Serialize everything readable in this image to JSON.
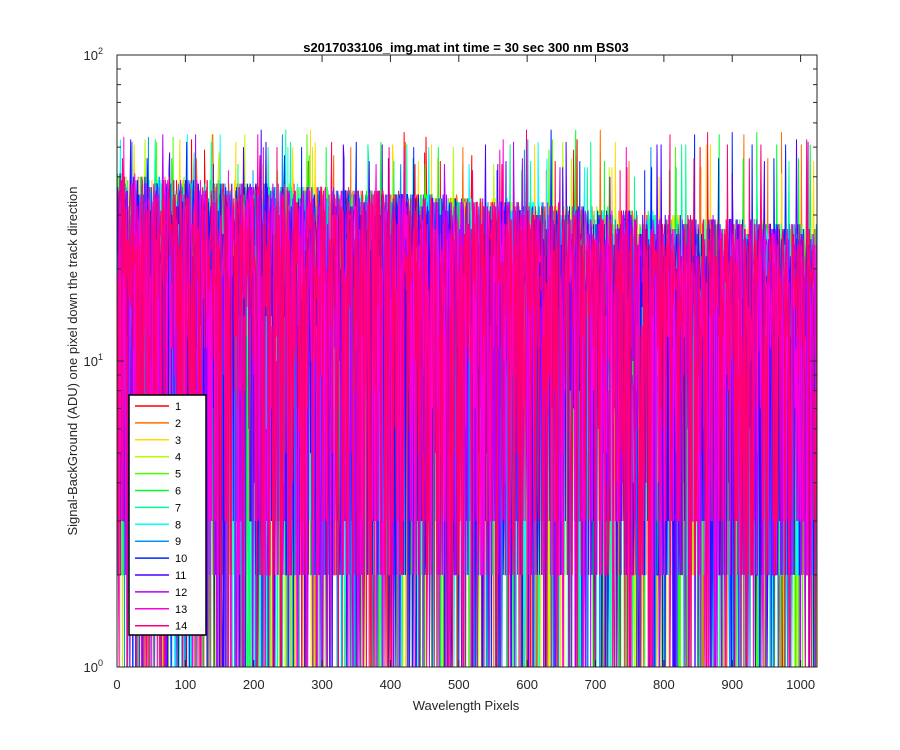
{
  "chart_data": {
    "type": "line",
    "title": "s2017033106_img.mat int time = 30 sec  300 nm BS03",
    "xlabel": "Wavelength Pixels",
    "ylabel": "Signal-BackGround (ADU) one pixel down the track direction",
    "xlim": [
      0,
      1024
    ],
    "ylim": [
      1,
      100
    ],
    "yscale": "log",
    "xticks": [
      "0",
      "100",
      "200",
      "300",
      "400",
      "500",
      "600",
      "700",
      "800",
      "900",
      "1000"
    ],
    "yticks": [
      {
        "base": "10",
        "exp": "0"
      },
      {
        "base": "10",
        "exp": "1"
      },
      {
        "base": "10",
        "exp": "2"
      }
    ],
    "legend_position": "bottom-left",
    "grid": false,
    "series": [
      {
        "name": "1",
        "color": "#ff0000"
      },
      {
        "name": "2",
        "color": "#ff6d00"
      },
      {
        "name": "3",
        "color": "#ffdb00"
      },
      {
        "name": "4",
        "color": "#b6ff00"
      },
      {
        "name": "5",
        "color": "#49ff00"
      },
      {
        "name": "6",
        "color": "#00ff24"
      },
      {
        "name": "7",
        "color": "#00ff92"
      },
      {
        "name": "8",
        "color": "#00ffff"
      },
      {
        "name": "9",
        "color": "#0092ff"
      },
      {
        "name": "10",
        "color": "#0024ff"
      },
      {
        "name": "11",
        "color": "#4900ff"
      },
      {
        "name": "12",
        "color": "#b600ff"
      },
      {
        "name": "13",
        "color": "#ff00db"
      },
      {
        "name": "14",
        "color": "#ff006d"
      }
    ],
    "data_description_values": {
      "typical_range": [
        2,
        50
      ],
      "peak_max": 57,
      "integer_valued_adu": true
    }
  }
}
